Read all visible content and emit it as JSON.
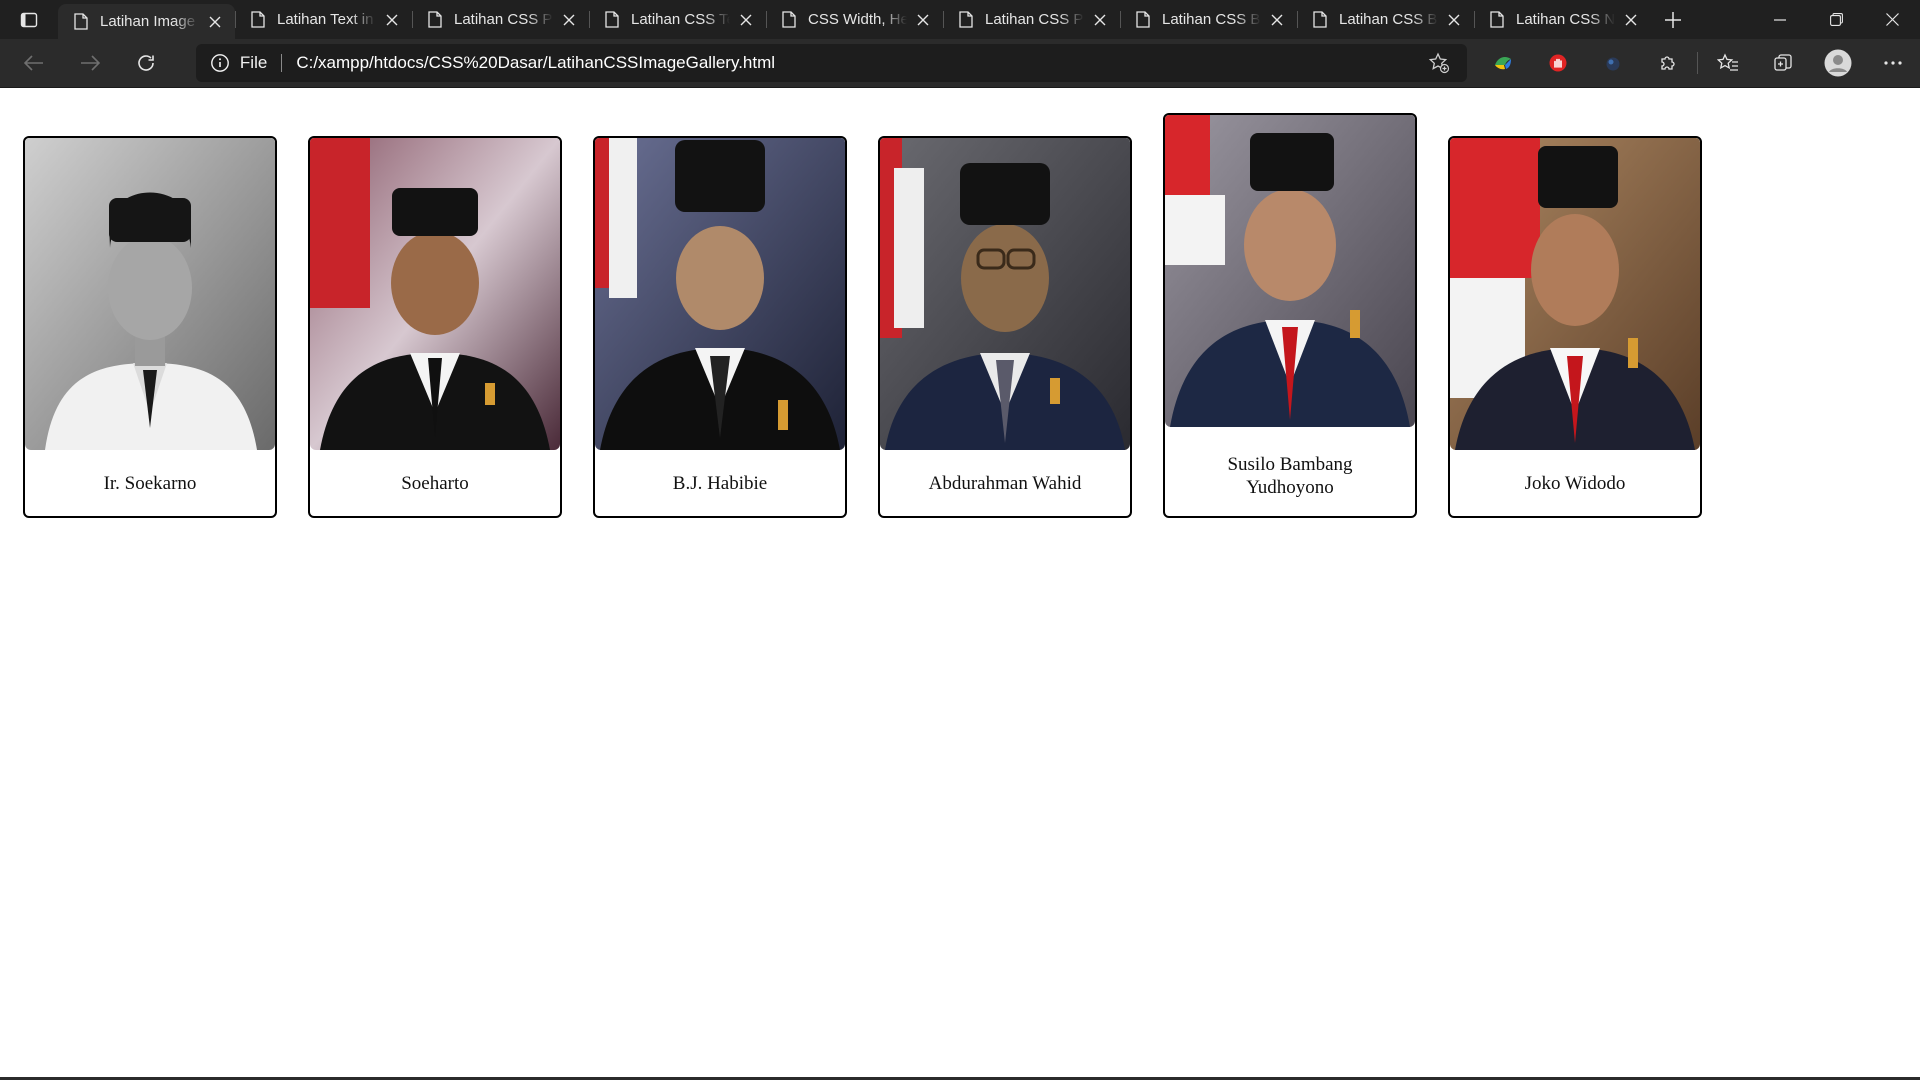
{
  "tabs": [
    {
      "title": "Latihan Image Gallery",
      "active": true
    },
    {
      "title": "Latihan Text in Image",
      "active": false
    },
    {
      "title": "Latihan CSS Position",
      "active": false
    },
    {
      "title": "Latihan CSS Text",
      "active": false
    },
    {
      "title": "CSS Width, Height",
      "active": false
    },
    {
      "title": "Latihan CSS Padding",
      "active": false
    },
    {
      "title": "Latihan CSS Border",
      "active": false
    },
    {
      "title": "Latihan CSS Box",
      "active": false
    },
    {
      "title": "Latihan CSS Navbar",
      "active": false
    }
  ],
  "addressbar": {
    "scheme_label": "File",
    "url": "C:/xampp/htdocs/CSS%20Dasar/LatihanCSSImageGallery.html"
  },
  "gallery": [
    {
      "name": "Ir. Soekarno",
      "tone": "bw",
      "bg": "#9a9a9a",
      "flag": false
    },
    {
      "name": "Soeharto",
      "tone": "color",
      "bg": "#6a3848",
      "flag": true
    },
    {
      "name": "B.J. Habibie",
      "tone": "color",
      "bg": "#3c4466",
      "flag": true
    },
    {
      "name": "Abdurahman Wahid",
      "tone": "color",
      "bg": "#4a4a52",
      "flag": true
    },
    {
      "name": "Susilo Bambang Yudhoyono",
      "tone": "color",
      "bg": "#6d6a74",
      "flag": true,
      "hover": true
    },
    {
      "name": "Joko Widodo",
      "tone": "color",
      "bg": "#8c6a4a",
      "flag": true
    }
  ],
  "colors": {
    "chrome_dark": "#202020",
    "chrome_mid": "#2b2b2b",
    "card_border": "#000000",
    "flag_red": "#d7262b",
    "tie_red": "#c4161c"
  }
}
